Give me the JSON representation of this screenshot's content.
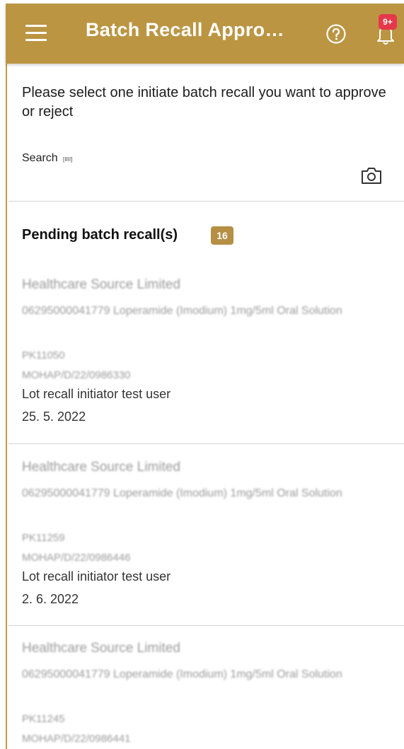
{
  "appbar": {
    "title": "Batch Recall Appro…",
    "notification_count": "9+"
  },
  "page": {
    "instruction": "Please select one initiate batch recall you want to approve or reject",
    "search_label": "Search",
    "barcode_glyph": "[IIII]",
    "section_title": "Pending batch recall(s)",
    "pending_count": "16"
  },
  "recalls": [
    {
      "company": "Healthcare Source Limited",
      "product": "06295000041779 Loperamide (Imodium) 1mg/5ml Oral Solution",
      "lot": "PK11050",
      "reference": "MOHAP/D/22/0986330",
      "initiator": "Lot recall initiator test user",
      "date": "25. 5. 2022"
    },
    {
      "company": "Healthcare Source Limited",
      "product": "06295000041779 Loperamide (Imodium) 1mg/5ml Oral Solution",
      "lot": "PK11259",
      "reference": "MOHAP/D/22/0986446",
      "initiator": "Lot recall initiator test user",
      "date": "2. 6. 2022"
    },
    {
      "company": "Healthcare Source Limited",
      "product": "06295000041779 Loperamide (Imodium) 1mg/5ml Oral Solution",
      "lot": "PK11245",
      "reference": "MOHAP/D/22/0986441",
      "initiator": "",
      "date": ""
    }
  ],
  "colors": {
    "appbar": "#bb9542",
    "badge": "#e5384b",
    "count_badge": "#b58f44"
  },
  "icons": [
    "menu-icon",
    "help-icon",
    "bell-icon",
    "camera-icon",
    "barcode-icon"
  ]
}
